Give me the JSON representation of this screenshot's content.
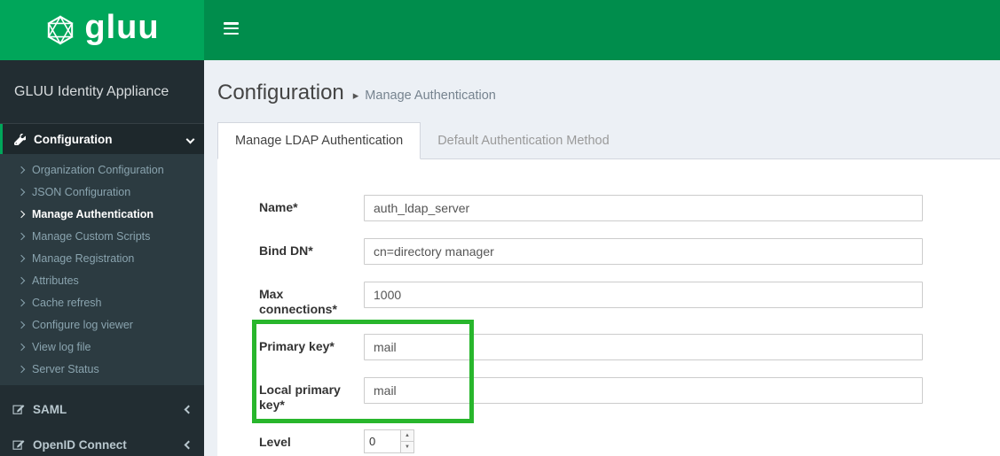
{
  "header": {
    "brand": "gluu",
    "appliance_title": "GLUU Identity Appliance"
  },
  "sidebar": {
    "sections": {
      "configuration": {
        "label": "Configuration"
      },
      "saml": {
        "label": "SAML"
      },
      "openid": {
        "label": "OpenID Connect"
      }
    },
    "config_submenu": [
      "Organization Configuration",
      "JSON Configuration",
      "Manage Authentication",
      "Manage Custom Scripts",
      "Manage Registration",
      "Attributes",
      "Cache refresh",
      "Configure log viewer",
      "View log file",
      "Server Status"
    ],
    "active_item": "Manage Authentication"
  },
  "content": {
    "breadcrumb": {
      "title": "Configuration",
      "separator": "▸",
      "crumb": "Manage Authentication"
    },
    "tabs": [
      {
        "label": "Manage LDAP Authentication",
        "active": true
      },
      {
        "label": "Default Authentication Method",
        "active": false
      }
    ],
    "form": {
      "fields": [
        {
          "label": "Name*",
          "value": "auth_ldap_server"
        },
        {
          "label": "Bind DN*",
          "value": "cn=directory manager"
        },
        {
          "label": "Max connections*",
          "value": "1000"
        },
        {
          "label": "Primary key*",
          "value": "mail",
          "highlighted": true
        },
        {
          "label": "Local primary key*",
          "value": "mail",
          "highlighted": true
        },
        {
          "label": "Level",
          "value": "0",
          "type": "number"
        }
      ]
    }
  },
  "colors": {
    "brand_green": "#00a65a",
    "navbar_green": "#008d4c",
    "sidebar_dark": "#222d32",
    "highlight_green": "#28b62c",
    "content_background": "#ecf0f5"
  }
}
